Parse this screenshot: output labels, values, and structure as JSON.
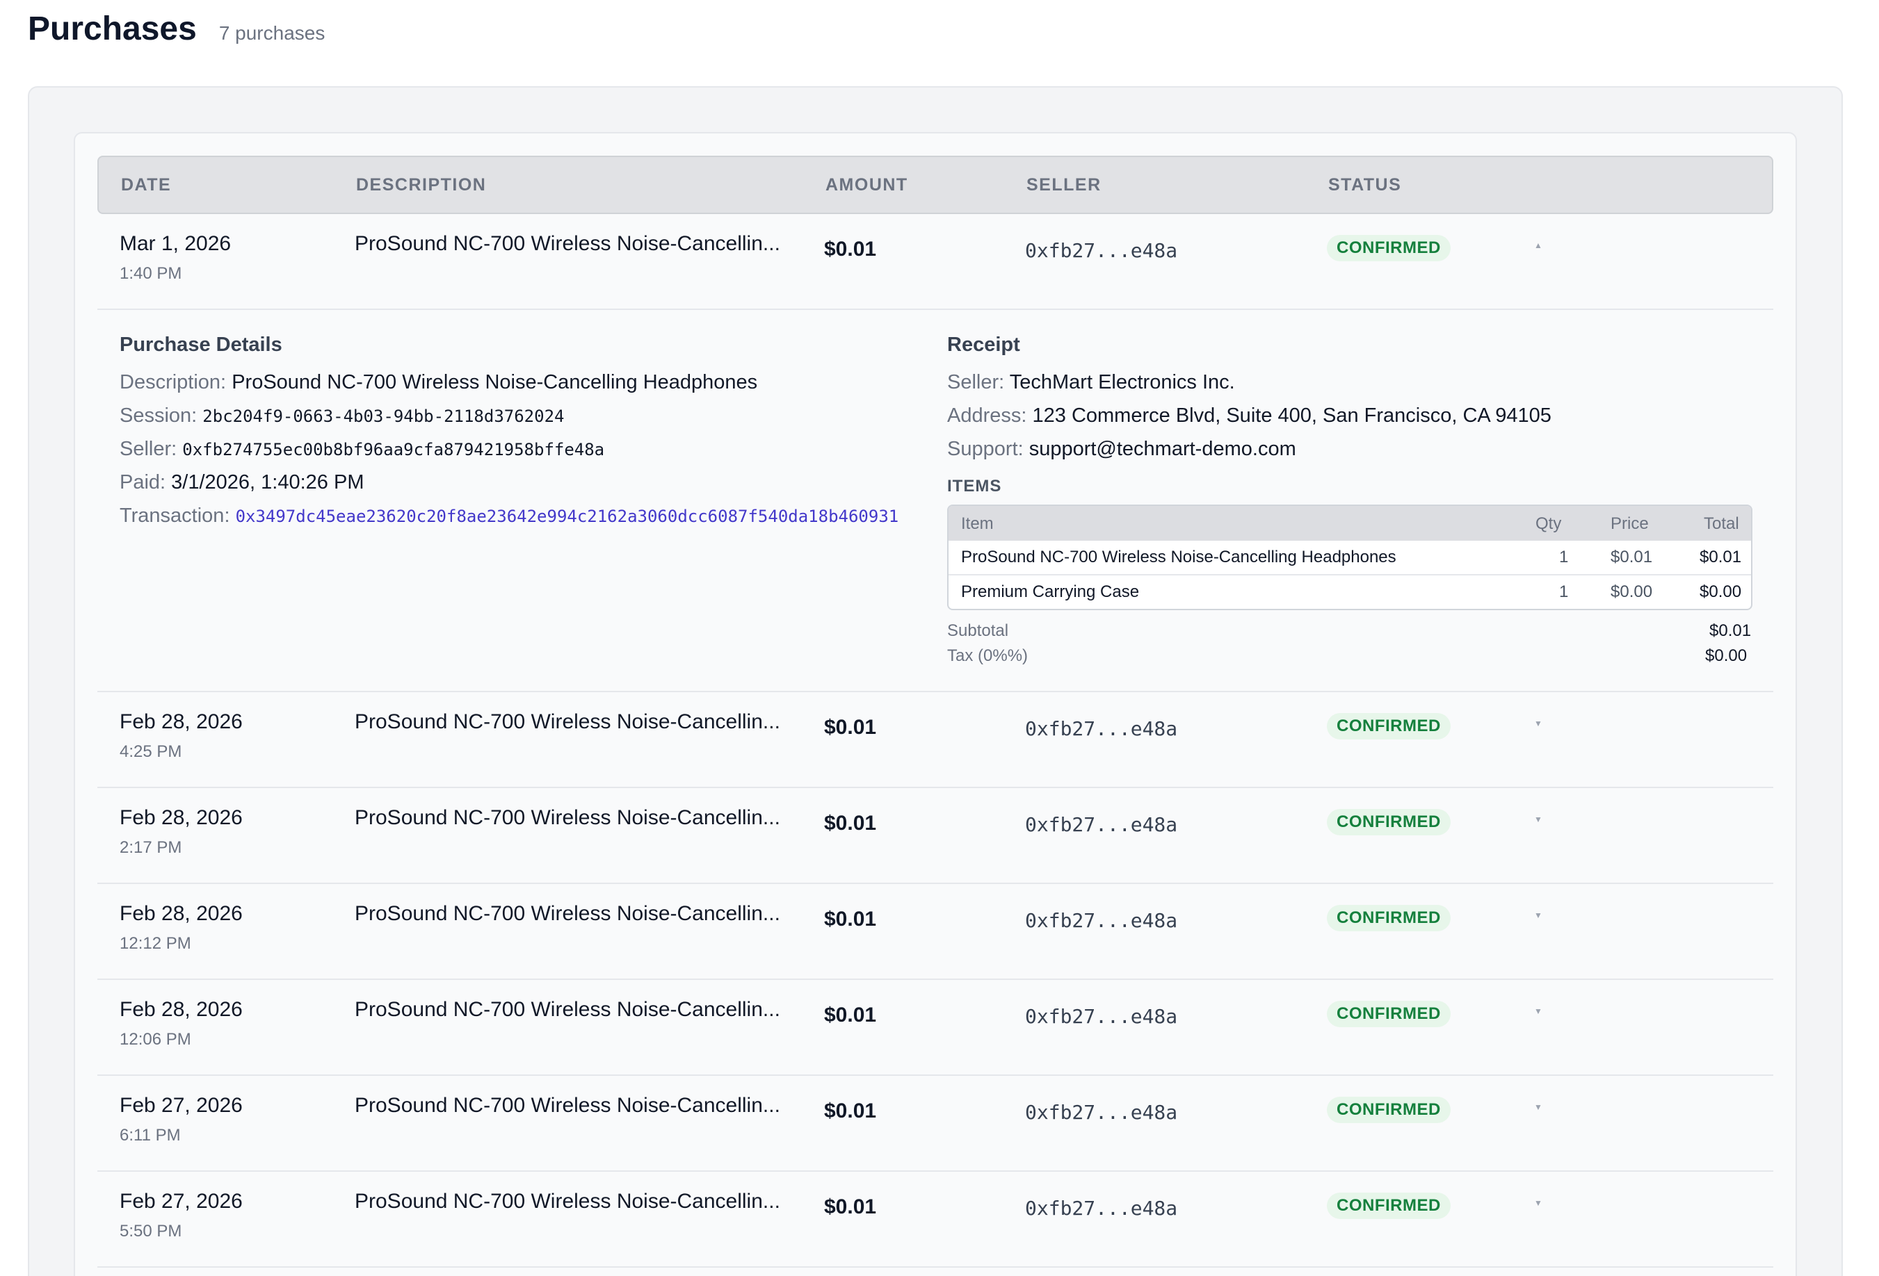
{
  "page": {
    "title": "Purchases",
    "count": "7 purchases"
  },
  "table": {
    "headers": {
      "date": "DATE",
      "description": "DESCRIPTION",
      "amount": "AMOUNT",
      "seller": "SELLER",
      "status": "STATUS"
    },
    "rows": [
      {
        "date": "Mar 1, 2026",
        "time": "1:40 PM",
        "description": "ProSound NC-700 Wireless Noise-Cancellin...",
        "amount": "$0.01",
        "seller": "0xfb27...e48a",
        "status": "CONFIRMED",
        "expand_icon": "chevron-up-icon"
      },
      {
        "date": "Feb 28, 2026",
        "time": "4:25 PM",
        "description": "ProSound NC-700 Wireless Noise-Cancellin...",
        "amount": "$0.01",
        "seller": "0xfb27...e48a",
        "status": "CONFIRMED",
        "expand_icon": "chevron-down-icon"
      },
      {
        "date": "Feb 28, 2026",
        "time": "2:17 PM",
        "description": "ProSound NC-700 Wireless Noise-Cancellin...",
        "amount": "$0.01",
        "seller": "0xfb27...e48a",
        "status": "CONFIRMED",
        "expand_icon": "chevron-down-icon"
      },
      {
        "date": "Feb 28, 2026",
        "time": "12:12 PM",
        "description": "ProSound NC-700 Wireless Noise-Cancellin...",
        "amount": "$0.01",
        "seller": "0xfb27...e48a",
        "status": "CONFIRMED",
        "expand_icon": "chevron-down-icon"
      },
      {
        "date": "Feb 28, 2026",
        "time": "12:06 PM",
        "description": "ProSound NC-700 Wireless Noise-Cancellin...",
        "amount": "$0.01",
        "seller": "0xfb27...e48a",
        "status": "CONFIRMED",
        "expand_icon": "chevron-down-icon"
      },
      {
        "date": "Feb 27, 2026",
        "time": "6:11 PM",
        "description": "ProSound NC-700 Wireless Noise-Cancellin...",
        "amount": "$0.01",
        "seller": "0xfb27...e48a",
        "status": "CONFIRMED",
        "expand_icon": "chevron-down-icon"
      },
      {
        "date": "Feb 27, 2026",
        "time": "5:50 PM",
        "description": "ProSound NC-700 Wireless Noise-Cancellin...",
        "amount": "$0.01",
        "seller": "0xfb27...e48a",
        "status": "CONFIRMED",
        "expand_icon": "chevron-down-icon"
      }
    ]
  },
  "details": {
    "title": "Purchase Details",
    "description_label": "Description:",
    "description": "ProSound NC-700 Wireless Noise-Cancelling Headphones",
    "session_label": "Session:",
    "session": "2bc204f9-0663-4b03-94bb-2118d3762024",
    "seller_label": "Seller:",
    "seller": "0xfb274755ec00b8bf96aa9cfa879421958bffe48a",
    "paid_label": "Paid:",
    "paid": "3/1/2026, 1:40:26 PM",
    "transaction_label": "Transaction:",
    "transaction": "0x3497dc45eae23620c20f8ae23642e994c2162a3060dcc6087f540da18b460931"
  },
  "receipt": {
    "title": "Receipt",
    "seller_label": "Seller:",
    "seller": "TechMart Electronics Inc.",
    "address_label": "Address:",
    "address": "123 Commerce Blvd, Suite 400, San Francisco, CA 94105",
    "support_label": "Support:",
    "support": "support@techmart-demo.com",
    "items_label": "ITEMS",
    "item_headers": {
      "item": "Item",
      "qty": "Qty",
      "price": "Price",
      "total": "Total"
    },
    "items": [
      {
        "item": "ProSound NC-700 Wireless Noise-Cancelling Headphones",
        "qty": "1",
        "price": "$0.01",
        "total": "$0.01"
      },
      {
        "item": "Premium Carrying Case",
        "qty": "1",
        "price": "$0.00",
        "total": "$0.00"
      }
    ],
    "subtotal_label": "Subtotal",
    "subtotal": "$0.01",
    "tax_label": "Tax (0%%)",
    "tax": "$0.00"
  },
  "colors": {
    "confirmed_text": "#15803d",
    "confirmed_bg": "#e7f6ea",
    "link": "#4338ca"
  }
}
